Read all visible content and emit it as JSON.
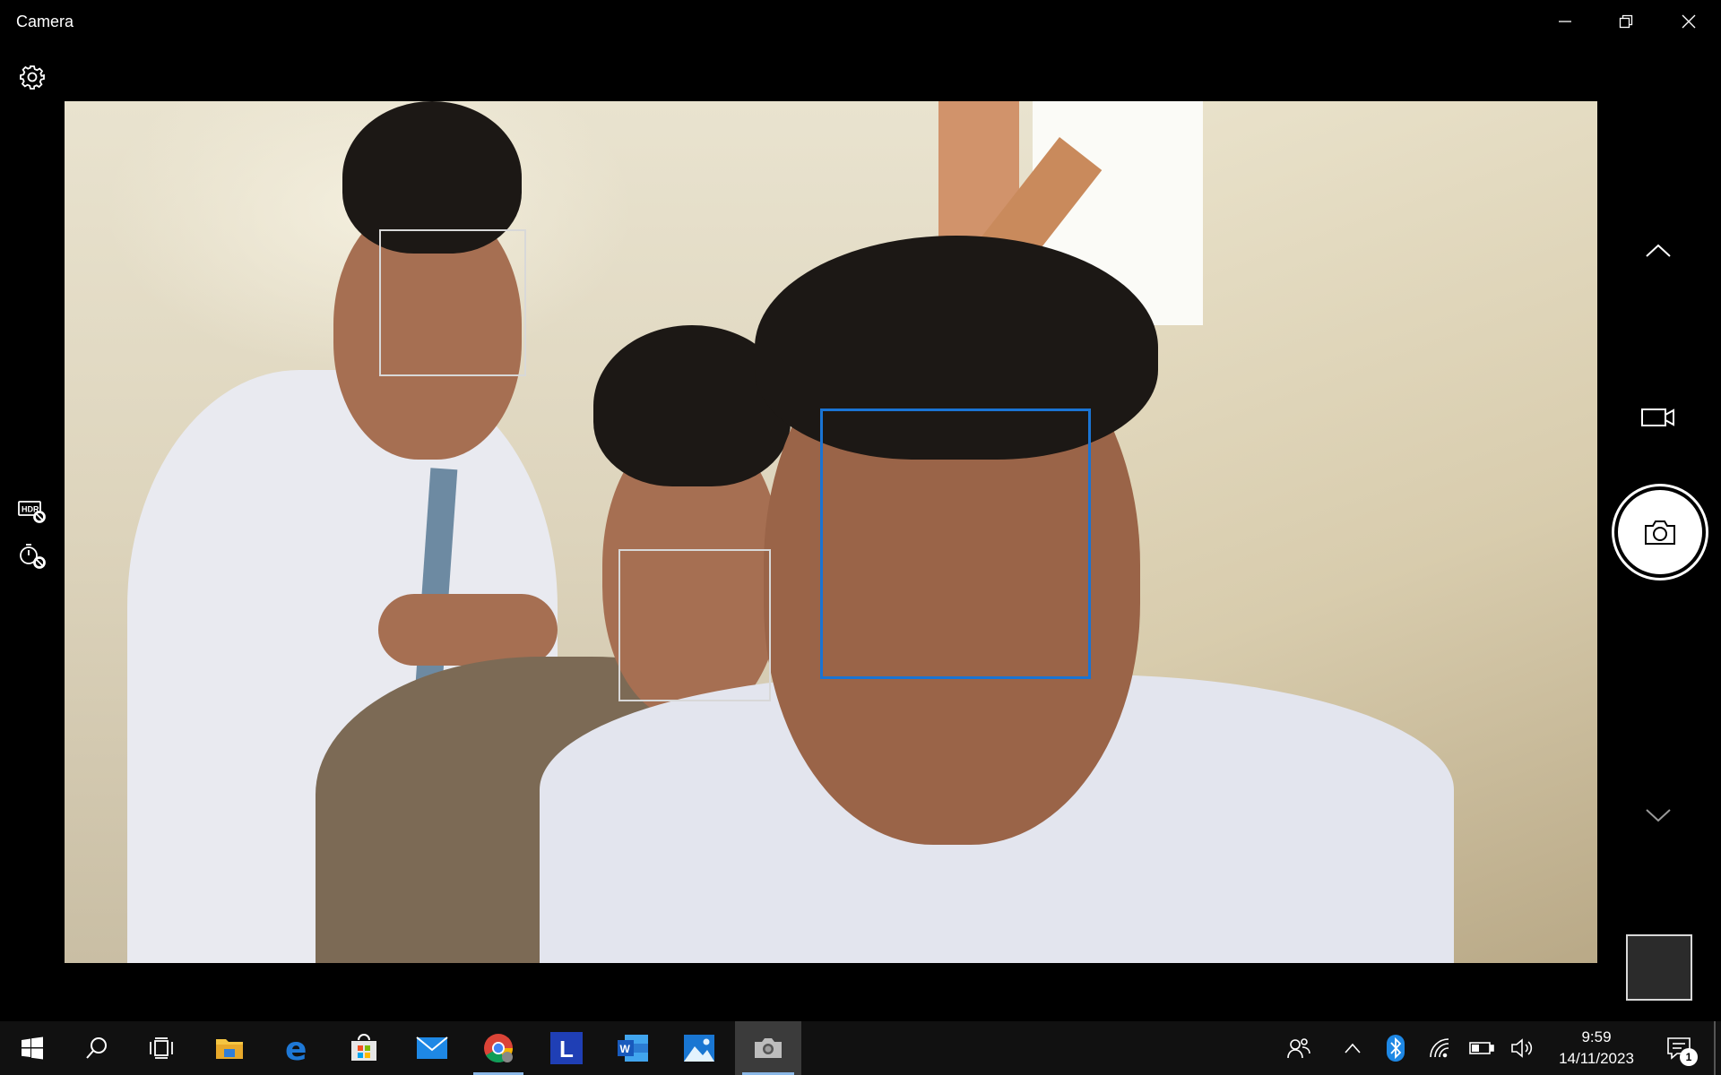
{
  "window": {
    "title": "Camera",
    "buttons": [
      "minimize",
      "restore",
      "close"
    ]
  },
  "toolbar": {
    "settings_icon": "gear-icon",
    "hdr_icon": "hdr-off-icon",
    "timer_icon": "timer-off-icon"
  },
  "viewfinder": {
    "faces_detected": 3,
    "colors": {
      "primary_face_box": "#1a74d4",
      "secondary_face_box": "#d8d8d8"
    }
  },
  "controls": {
    "scroll_up_icon": "chevron-up-icon",
    "video_mode_icon": "video-camera-icon",
    "shutter_icon": "camera-icon",
    "scroll_down_icon": "chevron-down-icon"
  },
  "taskbar": {
    "apps": [
      {
        "name": "Start",
        "icon": "windows-logo-icon"
      },
      {
        "name": "Search",
        "icon": "search-icon"
      },
      {
        "name": "Task View",
        "icon": "task-view-icon"
      },
      {
        "name": "File Explorer",
        "icon": "folder-icon"
      },
      {
        "name": "Microsoft Edge",
        "icon": "edge-icon"
      },
      {
        "name": "Microsoft Store",
        "icon": "store-icon"
      },
      {
        "name": "Mail",
        "icon": "mail-icon"
      },
      {
        "name": "Google Chrome",
        "icon": "chrome-icon"
      },
      {
        "name": "L",
        "icon": "l-app-icon"
      },
      {
        "name": "Word",
        "icon": "word-icon"
      },
      {
        "name": "Photos",
        "icon": "photos-icon"
      },
      {
        "name": "Camera",
        "icon": "camera-app-icon"
      }
    ],
    "tray": {
      "icons": [
        "people-icon",
        "chevron-up-icon",
        "bluetooth-icon",
        "wifi-icon",
        "battery-icon",
        "volume-icon"
      ],
      "time": "9:59",
      "date": "14/11/2023",
      "notification_count": "1"
    }
  }
}
